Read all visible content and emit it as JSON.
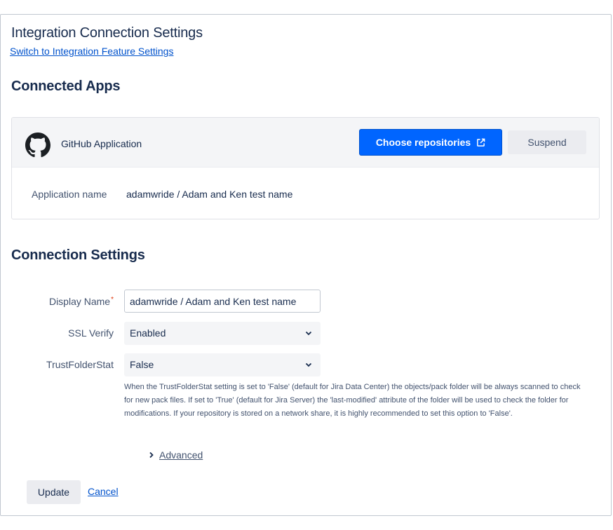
{
  "page": {
    "title": "Integration Connection Settings",
    "switch_link": "Switch to Integration Feature Settings"
  },
  "connected_apps": {
    "title": "Connected Apps",
    "app": {
      "icon": "github-icon",
      "name": "GitHub Application",
      "choose_button": "Choose repositories",
      "suspend_button": "Suspend",
      "app_name_label": "Application name",
      "app_name_value": "adamwride / Adam and Ken test name"
    }
  },
  "connection_settings": {
    "title": "Connection Settings",
    "display_name": {
      "label": "Display Name",
      "required_mark": "*",
      "value": "adamwride / Adam and Ken test name"
    },
    "ssl_verify": {
      "label": "SSL Verify",
      "value": "Enabled"
    },
    "trust_folder_stat": {
      "label": "TrustFolderStat",
      "value": "False",
      "help": "When the TrustFolderStat setting is set to 'False' (default for Jira Data Center) the objects/pack folder will be always scanned to check for new pack files. If set to 'True' (default for Jira Server) the 'last-modified' attribute of the folder will be used to check the folder for modifications. If your repository is stored on a network share, it is highly recommended to set this option to 'False'."
    },
    "advanced_label": "Advanced"
  },
  "actions": {
    "update_button": "Update",
    "cancel_link": "Cancel"
  },
  "colors": {
    "primary": "#0065ff",
    "link": "#0052cc",
    "required": "#de350b"
  }
}
